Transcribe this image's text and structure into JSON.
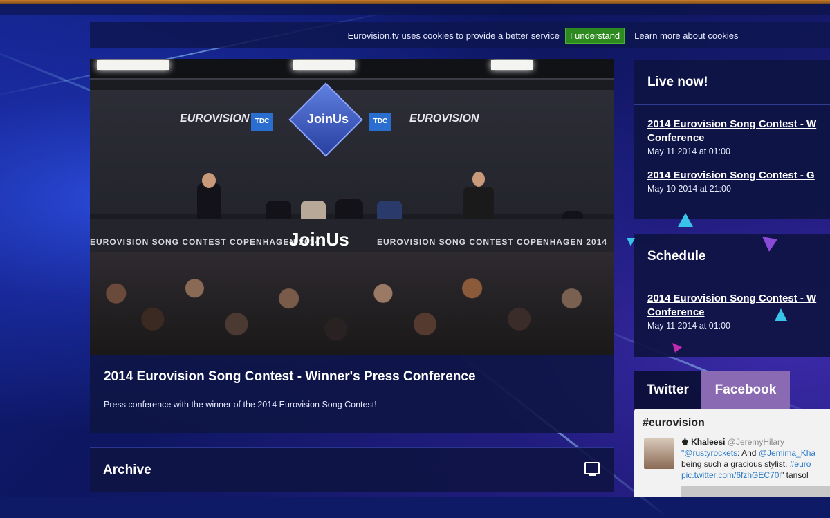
{
  "cookie": {
    "message": "Eurovision.tv uses cookies to provide a better service",
    "accept_label": "I understand",
    "learn_more_label": "Learn more about cookies"
  },
  "video": {
    "stage_logo_text": "JoinUs",
    "desk_text_left": "EUROVISION SONG CONTEST COPENHAGEN 2014",
    "desk_text_right": "EUROVISION SONG CONTEST COPENHAGEN 2014",
    "brand_left": "EUROVISION",
    "brand_right": "EUROVISION",
    "tdc_label": "TDC"
  },
  "main": {
    "title": "2014 Eurovision Song Contest - Winner's Press Conference",
    "description": "Press conference with the winner of the 2014 Eurovision Song Contest!"
  },
  "archive": {
    "title": "Archive"
  },
  "live_now": {
    "title": "Live now!",
    "events": [
      {
        "title": "2014 Eurovision Song Contest - W",
        "title_line2": "Conference",
        "time": "May 11 2014 at 01:00"
      },
      {
        "title": "2014 Eurovision Song Contest - G",
        "title_line2": "",
        "time": "May 10 2014 at 21:00"
      }
    ]
  },
  "schedule": {
    "title": "Schedule",
    "events": [
      {
        "title": "2014 Eurovision Song Contest - W",
        "title_line2": "Conference",
        "time": "May 11 2014 at 01:00"
      }
    ]
  },
  "social": {
    "tabs": [
      "Twitter",
      "Facebook"
    ],
    "active_tab": "Facebook",
    "hashtag": "#eurovision",
    "tweet": {
      "user": "Khaleesi",
      "handle": "@JeremyHilary",
      "line1_a": "\"@rustyrockets",
      "line1_b": ": And ",
      "line1_c": "@Jemima_Kha",
      "line2_a": "being such a gracious stylist. ",
      "line2_b": "#euro",
      "line3_a": "pic.twitter.com/6fzhGEC70l",
      "line3_b": "\" tansol"
    }
  },
  "colors": {
    "accept_green": "#2d8a1e",
    "facebook_tab": "#8a6ab2",
    "panel_bg": "#0e1442"
  }
}
